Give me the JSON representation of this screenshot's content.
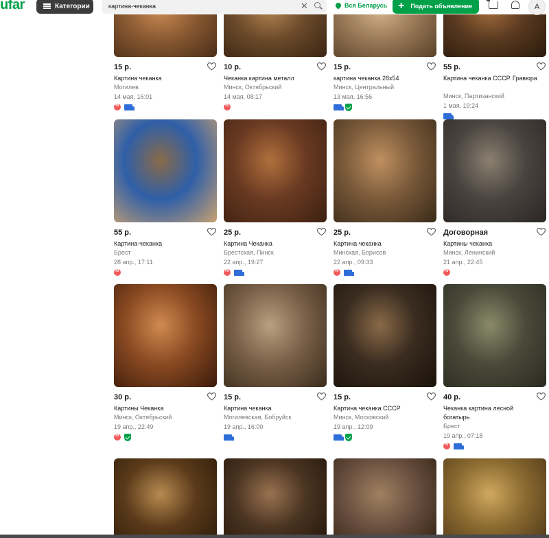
{
  "header": {
    "logo": "ufar",
    "categories_label": "Категории",
    "search_value": "картина-чеканка",
    "clear_symbol": "✕",
    "region_label": "Вся Беларусь",
    "post_label": "Подать объявление",
    "avatar_letter": "A"
  },
  "colors": {
    "brand_green": "#00a049",
    "discount_red": "#f05a5a",
    "delivery_blue": "#2f6ed8"
  },
  "listings": [
    {
      "price": "15 р.",
      "title": "Картина чеканка",
      "location": "Могилев",
      "date": "14 мая, 16:01",
      "badges": [
        "discount-icon",
        "delivery-icon"
      ]
    },
    {
      "price": "10 р.",
      "title": "Чеканка картина металл",
      "location": "Минск, Октябрьский",
      "date": "14 мая, 08:17",
      "badges": [
        "discount-icon"
      ]
    },
    {
      "price": "15 р.",
      "title": "картина чеканка 28х54",
      "location": "Минск, Центральный",
      "date": "13 мая, 16:56",
      "badges": [
        "delivery-icon",
        "safe-deal-icon"
      ]
    },
    {
      "price": "55 р.",
      "title": "Картина чеканка СССР. Гравюра",
      "location": "Минск, Партизанский",
      "date": "1 мая, 19:24",
      "badges": [
        "delivery-icon"
      ]
    },
    {
      "price": "55 р.",
      "title": "Картина-чеканка",
      "location": "Брест",
      "date": "28 апр., 17:11",
      "badges": [
        "discount-icon"
      ]
    },
    {
      "price": "25 р.",
      "title": "Картина Чеканка",
      "location": "Брестская, Пинск",
      "date": "22 апр., 19:27",
      "badges": [
        "discount-icon",
        "delivery-icon"
      ]
    },
    {
      "price": "25 р.",
      "title": "Картина чеканка",
      "location": "Минская, Борисов",
      "date": "22 апр., 09:33",
      "badges": [
        "discount-icon",
        "delivery-icon"
      ]
    },
    {
      "price": "Договорная",
      "title": "Картины чеканка",
      "location": "Минск, Ленинский",
      "date": "21 апр., 22:45",
      "badges": [
        "discount-icon"
      ]
    },
    {
      "price": "30 р.",
      "title": "Картины Чеканка",
      "location": "Минск, Октябрьский",
      "date": "19 апр., 22:49",
      "badges": [
        "discount-icon",
        "safe-deal-icon"
      ]
    },
    {
      "price": "15 р.",
      "title": "Картина чеканка",
      "location": "Могилевская, Бобруйск",
      "date": "19 апр., 16:00",
      "badges": [
        "delivery-icon"
      ]
    },
    {
      "price": "15 р.",
      "title": "Картина чеканка СССР",
      "location": "Минск, Московский",
      "date": "19 апр., 12:09",
      "badges": [
        "delivery-icon",
        "safe-deal-icon"
      ]
    },
    {
      "price": "40 р.",
      "title": "Чеканка картина лесной богатырь",
      "location": "Брест",
      "date": "19 апр., 07:18",
      "badges": [
        "discount-icon",
        "delivery-icon"
      ]
    },
    {
      "price": "",
      "title": "",
      "location": "",
      "date": "",
      "badges": []
    },
    {
      "price": "",
      "title": "",
      "location": "",
      "date": "",
      "badges": []
    },
    {
      "price": "",
      "title": "",
      "location": "",
      "date": "",
      "badges": []
    },
    {
      "price": "",
      "title": "",
      "location": "",
      "date": "",
      "badges": []
    }
  ]
}
